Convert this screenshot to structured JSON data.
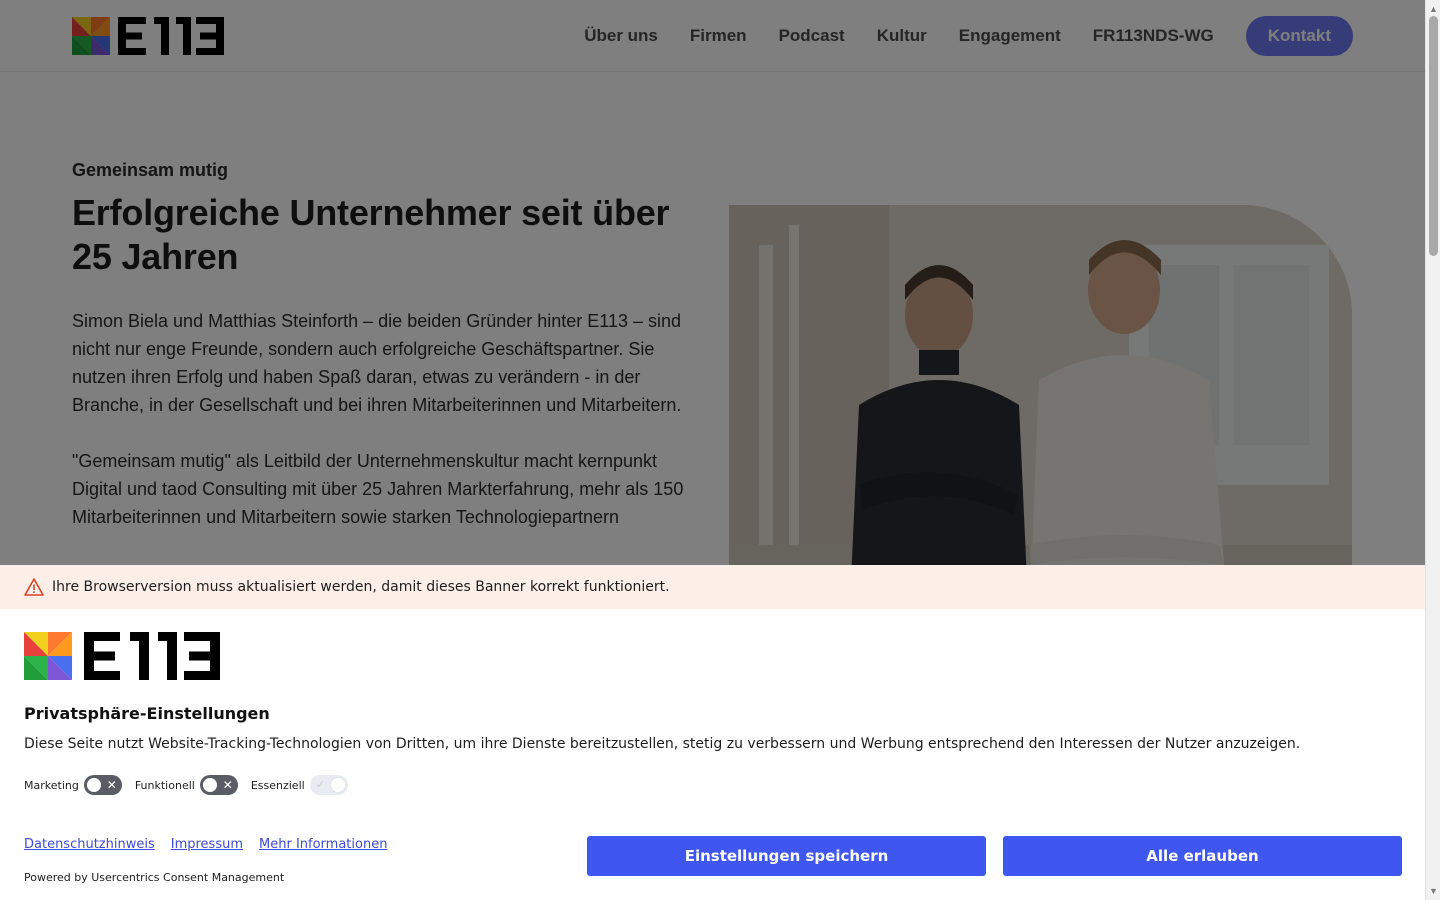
{
  "header": {
    "logo_text": "E113",
    "nav": [
      "Über uns",
      "Firmen",
      "Podcast",
      "Kultur",
      "Engagement",
      "FR113NDS-WG"
    ],
    "contact_label": "Kontakt"
  },
  "hero": {
    "eyebrow": "Gemeinsam mutig",
    "title": "Erfolgreiche Unternehmer seit über 25 Jahren",
    "paragraph_1": "Simon Biela und Matthias Steinforth – die beiden Gründer hinter E113 – sind nicht nur enge Freunde, sondern auch erfolgreiche Geschäftspartner. Sie nutzen ihren Erfolg und haben Spaß daran, etwas zu verändern - in der Branche, in der Gesellschaft und bei ihren Mitarbeiterinnen und Mitarbeitern.",
    "paragraph_2": "\"Gemeinsam mutig\" als Leitbild der Unternehmenskultur macht kernpunkt Digital und taod Consulting mit über 25 Jahren Markterfahrung, mehr als 150 Mitarbeiterinnen und Mitarbeitern sowie starken Technologiepartnern"
  },
  "consent": {
    "warning_text": "Ihre Browserversion muss aktualisiert werden, damit dieses Banner korrekt funktioniert.",
    "logo_text": "E113",
    "title": "Privatsphäre-Einstellungen",
    "description": "Diese Seite nutzt Website-Tracking-Technologien von Dritten, um ihre Dienste bereitzustellen, stetig zu verbessern und Werbung entsprechend den Interessen der Nutzer anzuzeigen.",
    "toggles": [
      {
        "label": "Marketing",
        "on": false
      },
      {
        "label": "Funktionell",
        "on": false
      },
      {
        "label": "Essenziell",
        "on": true
      }
    ],
    "links": [
      "Datenschutzhinweis",
      "Impressum",
      "Mehr Informationen"
    ],
    "powered_by": "Powered by Usercentrics Consent Management",
    "save_label": "Einstellungen speichern",
    "accept_all_label": "Alle erlauben"
  },
  "colors": {
    "accent_button": "#3f56f0",
    "nav_contact": "#6b78f0",
    "warning_bg": "#fdeee8",
    "link": "#3d4bd6"
  }
}
